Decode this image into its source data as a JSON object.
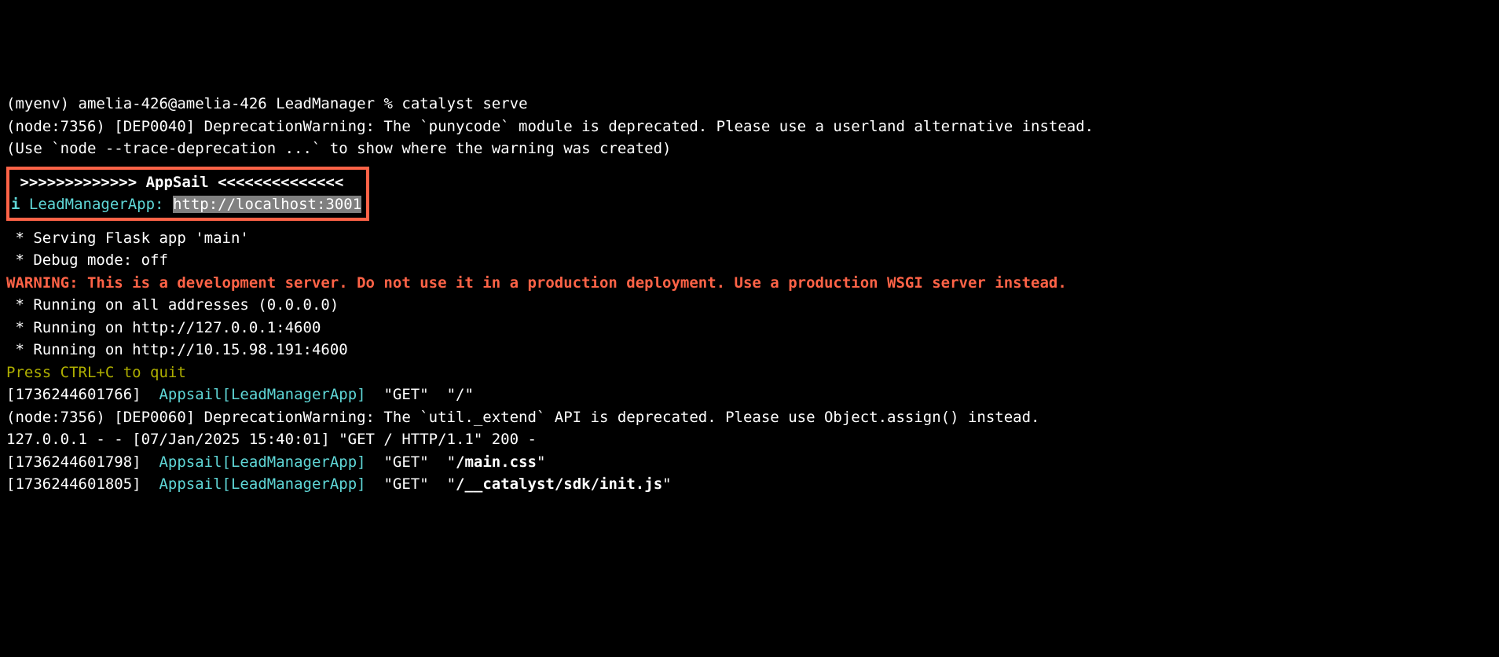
{
  "prompt": {
    "env": "(myenv)",
    "userhost": "amelia-426@amelia-426",
    "dir": "LeadManager",
    "symbol": "%",
    "command": "catalyst serve"
  },
  "deprecation1": "(node:7356) [DEP0040] DeprecationWarning: The `punycode` module is deprecated. Please use a userland alternative instead.",
  "trace_hint": "(Use `node --trace-deprecation ...` to show where the warning was created)",
  "appsail_banner": {
    "line": ">>>>>>>>>>>>> AppSail <<<<<<<<<<<<<<",
    "info_label": "LeadManagerApp:",
    "info_url": "http://localhost:3001",
    "info_prefix": "i"
  },
  "flask": {
    "serving": " * Serving Flask app 'main'",
    "debug": " * Debug mode: off"
  },
  "warning": "WARNING: This is a development server. Do not use it in a production deployment. Use a production WSGI server instead.",
  "running": {
    "all": " * Running on all addresses (0.0.0.0)",
    "local": " * Running on http://127.0.0.1:4600",
    "lan": " * Running on http://10.15.98.191:4600"
  },
  "ctrl_c": "Press CTRL+C to quit",
  "logs": [
    {
      "ts": "[1736244601766]",
      "svc": "Appsail[LeadManagerApp]",
      "method": "\"GET\"",
      "path": "\"/\""
    }
  ],
  "deprecation2": "(node:7356) [DEP0060] DeprecationWarning: The `util._extend` API is deprecated. Please use Object.assign() instead.",
  "access_log": "127.0.0.1 - - [07/Jan/2025 15:40:01] \"GET / HTTP/1.1\" 200 -",
  "logs2": [
    {
      "ts": "[1736244601798]",
      "svc": "Appsail[LeadManagerApp]",
      "method": "\"GET\"",
      "path_prefix": "\"",
      "path_bold": "/main.css",
      "path_suffix": "\""
    },
    {
      "ts": "[1736244601805]",
      "svc": "Appsail[LeadManagerApp]",
      "method": "\"GET\"",
      "path_prefix": "\"",
      "path_bold": "/__catalyst/sdk/init.js",
      "path_suffix": "\""
    }
  ]
}
